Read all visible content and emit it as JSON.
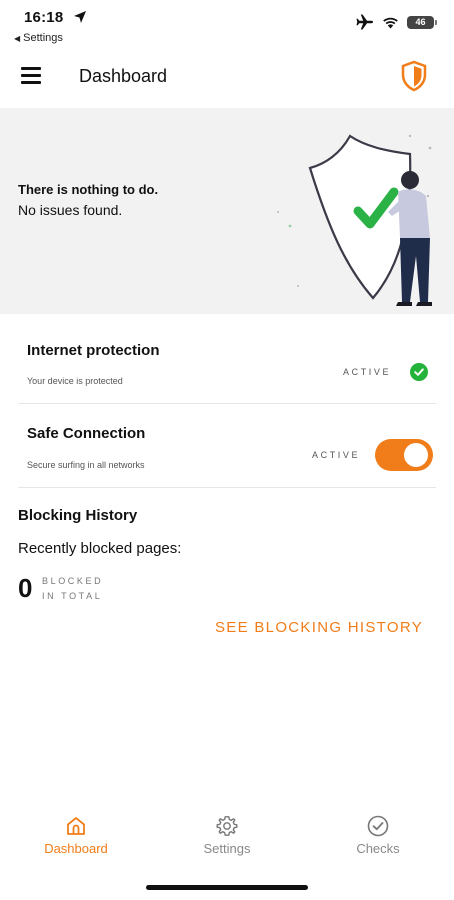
{
  "status_bar": {
    "time": "16:18",
    "back_label": "Settings",
    "battery": "46"
  },
  "app_bar": {
    "title": "Dashboard"
  },
  "hero": {
    "title": "There is nothing to do.",
    "subtitle": "No issues found."
  },
  "protections": [
    {
      "title": "Internet protection",
      "description": "Your device is protected",
      "status": "ACTIVE",
      "control": "check"
    },
    {
      "title": "Safe Connection",
      "description": "Secure surfing in all networks",
      "status": "ACTIVE",
      "control": "toggle",
      "enabled": true
    }
  ],
  "blocking_history": {
    "title": "Blocking History",
    "subtitle": "Recently blocked pages:",
    "count": "0",
    "count_label_line1": "BLOCKED",
    "count_label_line2": "IN TOTAL",
    "link": "SEE BLOCKING HISTORY"
  },
  "bottom_nav": [
    {
      "label": "Dashboard",
      "icon": "home-icon",
      "active": true
    },
    {
      "label": "Settings",
      "icon": "gear-icon",
      "active": false
    },
    {
      "label": "Checks",
      "icon": "check-circle-icon",
      "active": false
    }
  ],
  "colors": {
    "accent": "#f07d1a",
    "success": "#23b23a",
    "hero_bg": "#f2f2f2"
  }
}
